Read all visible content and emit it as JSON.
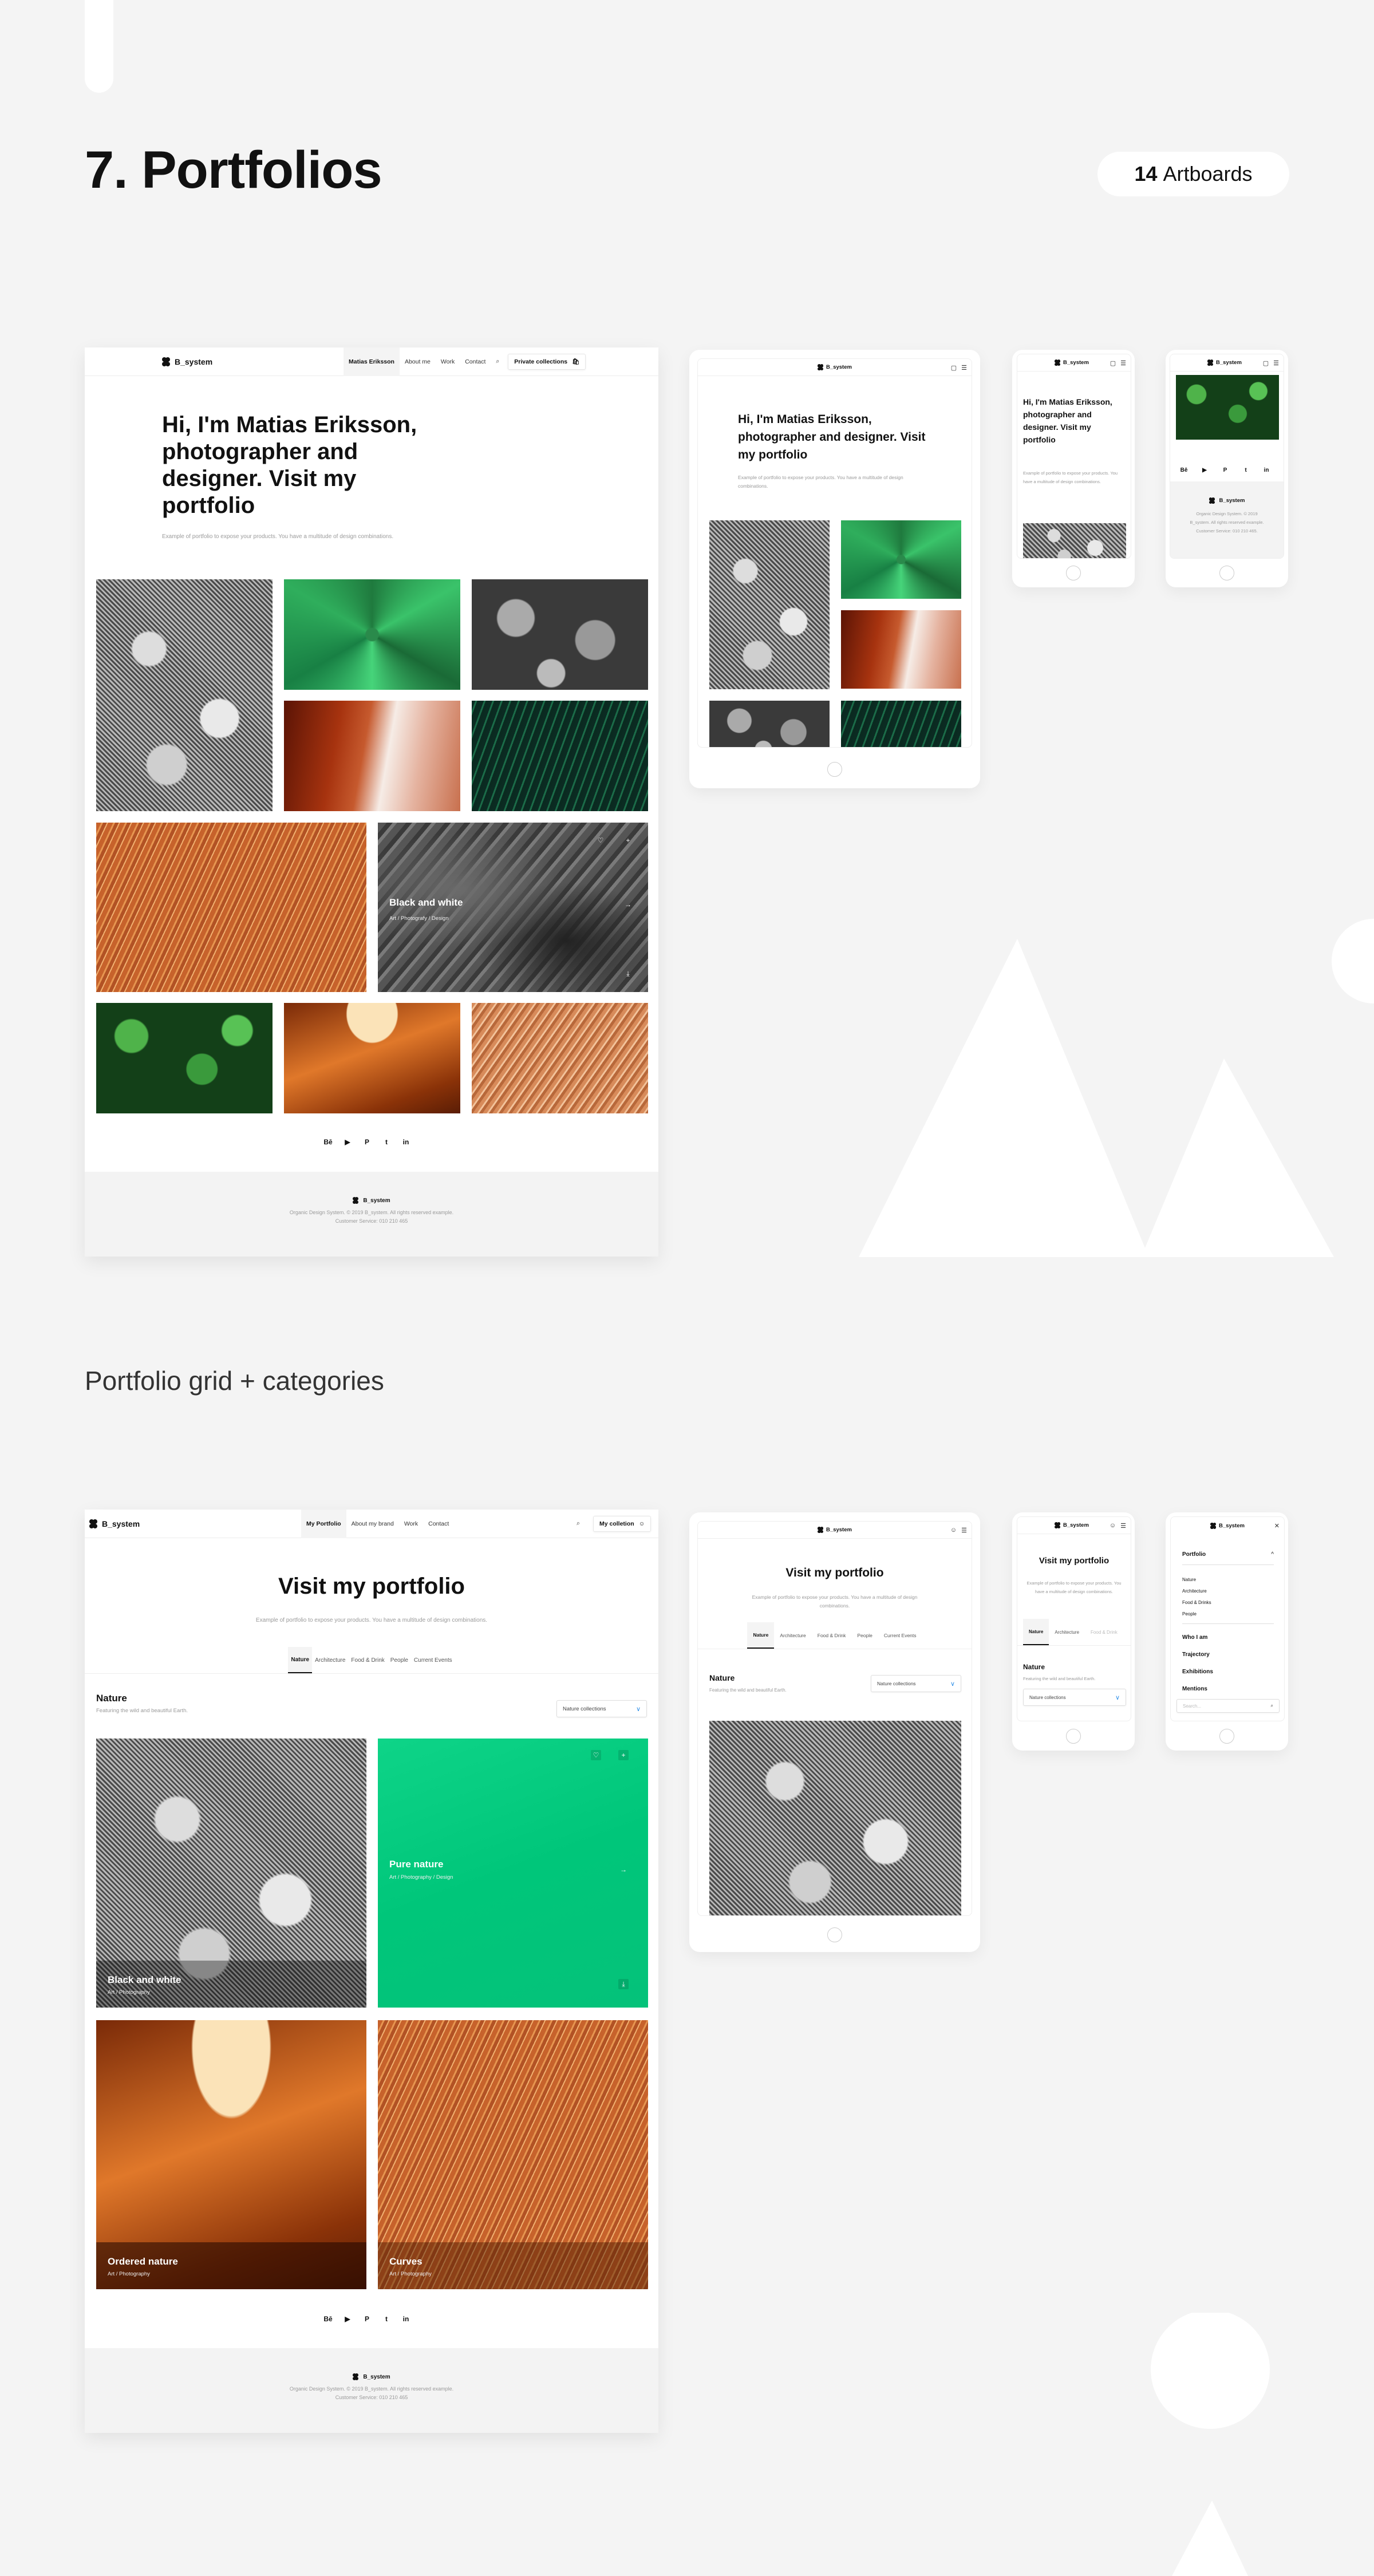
{
  "header": {
    "title": "7. Portfolios",
    "artboards_count": "14",
    "artboards_label": "Artboards"
  },
  "brand": "B_system",
  "section2_title": "Portfolio grid + categories",
  "portfolio1": {
    "nav": {
      "items": [
        "Matias Eriksson",
        "About me",
        "Work",
        "Contact"
      ],
      "active_index": 0,
      "cta_label": "Private collections",
      "cta_icon": "shopping-bag-icon",
      "search_icon": "search-icon"
    },
    "hero_title": "Hi, I'm Matias Eriksson, photographer and designer. Visit my portfolio",
    "hero_subtitle": "Example of portfolio to expose your products. You have a multitude of design combinations.",
    "featured_card": {
      "title": "Black and white",
      "subtitle": "Art / Photografy / Design",
      "icons": [
        "heart-icon",
        "plus-icon",
        "arrow-right-icon",
        "download-icon"
      ]
    },
    "images": [
      "bw-leaves",
      "green-agave",
      "bw-oak-leaves",
      "red-canyon",
      "palm-leaf",
      "orange-waves",
      "bw-rock",
      "green-plant",
      "orange-canyon",
      "orange-waves-2"
    ]
  },
  "social_icons": [
    "behance-icon",
    "youtube-icon",
    "pinterest-icon",
    "twitter-icon",
    "linkedin-icon"
  ],
  "social_glyphs": [
    "Bē",
    "▶",
    "P",
    "t",
    "in"
  ],
  "footer": {
    "line1": "Organic Design System. © 2019 B_system. All rights reserved example.",
    "line2": "Customer Service: 010 210 465",
    "mobile_line1": "Organic Design System. © 2019",
    "mobile_line2": "B_system. All rights reserved example.",
    "mobile_line3": "Customer Service: 010 210 465."
  },
  "tablet1": {
    "hero_title": "Hi, I'm Matias Eriksson, photographer and designer. Visit my portfolio",
    "hero_subtitle": "Example of portfolio to expose your products. You have a multitude of design combinations."
  },
  "mobile1": {
    "hero_title": "Hi, I'm Matias Eriksson, photographer and designer. Visit my portfolio",
    "hero_subtitle": "Example of portfolio to expose your products. You have a multitude of design combinations."
  },
  "portfolio2": {
    "nav": {
      "items": [
        "My Portfolio",
        "About my brand",
        "Work",
        "Contact"
      ],
      "active_index": 0,
      "cta_label": "My colletion",
      "cta_icon": "user-icon",
      "search_icon": "search-icon"
    },
    "hero_title": "Visit my portfolio",
    "hero_subtitle": "Example of portfolio to expose your products. You have a multitude of design combinations.",
    "tabs": [
      "Nature",
      "Architecture",
      "Food & Drink",
      "People",
      "Current Events"
    ],
    "active_tab": "Nature",
    "category_title": "Nature",
    "category_subtitle": "Featuring the wild and beautiful Earth.",
    "select_value": "Nature collections",
    "cards": [
      {
        "title": "Black and white",
        "subtitle": "Art / Photography"
      },
      {
        "title": "Pure nature",
        "subtitle": "Art / Photography / Design",
        "color": "#00c67a"
      },
      {
        "title": "Ordered nature",
        "subtitle": "Art / Photography"
      },
      {
        "title": "Curves",
        "subtitle": "Art / Photography"
      }
    ]
  },
  "mobile_menu": {
    "section_label": "Portfolio",
    "sub_items": [
      "Nature",
      "Architecture",
      "Food & Drinks",
      "People"
    ],
    "main_items": [
      "Who I am",
      "Trajectory",
      "Exhibitions",
      "Mentions"
    ],
    "search_placeholder": "Search..."
  },
  "colors": {
    "accent_green": "#00c67a",
    "chevron_blue": "#2e8fe8",
    "background": "#f4f4f4"
  }
}
